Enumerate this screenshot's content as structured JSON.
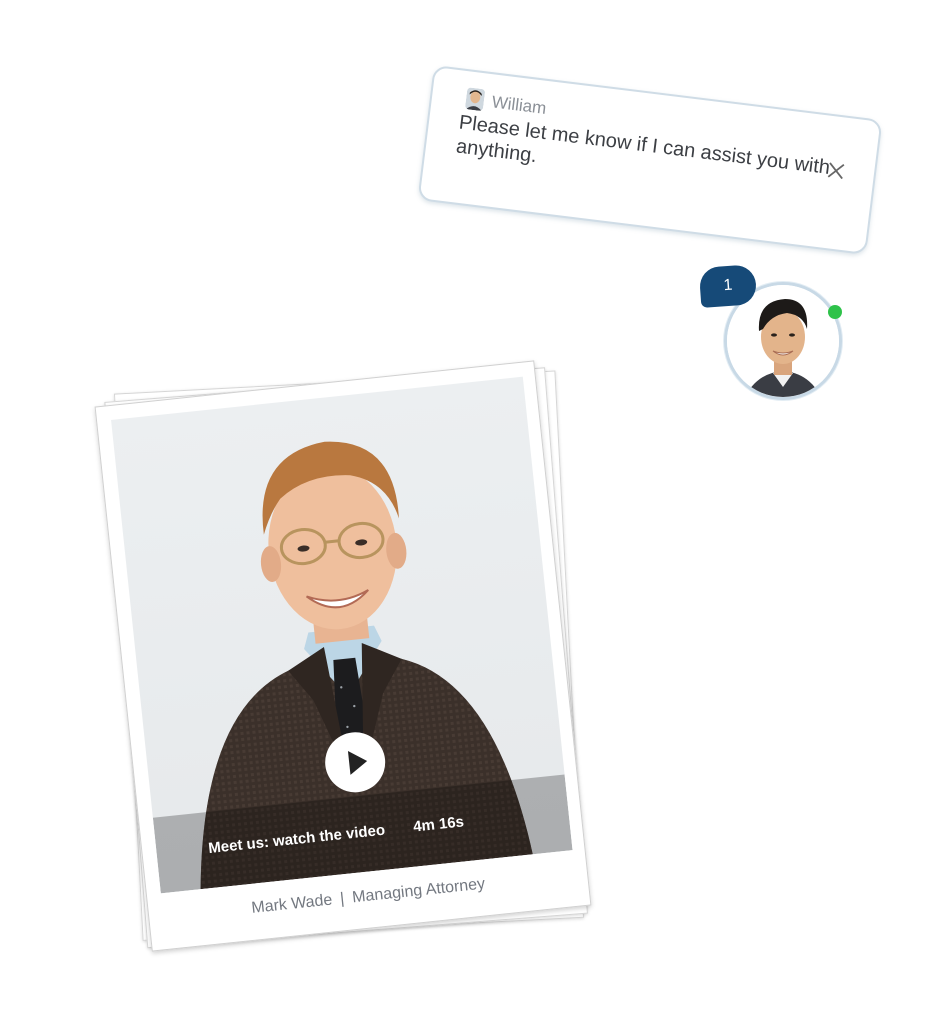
{
  "chat": {
    "agent_name": "William",
    "message": "Please let me know if I can assist you with anything.",
    "close_icon": "close-icon"
  },
  "launcher": {
    "unread_count": "1",
    "status": "online",
    "status_color": "#2ec24a",
    "badge_color": "#164a78"
  },
  "video_card": {
    "cta_label": "Meet us: watch the video",
    "duration": "4m 16s",
    "person_name": "Mark Wade",
    "separator": "|",
    "person_title": "Managing Attorney"
  }
}
